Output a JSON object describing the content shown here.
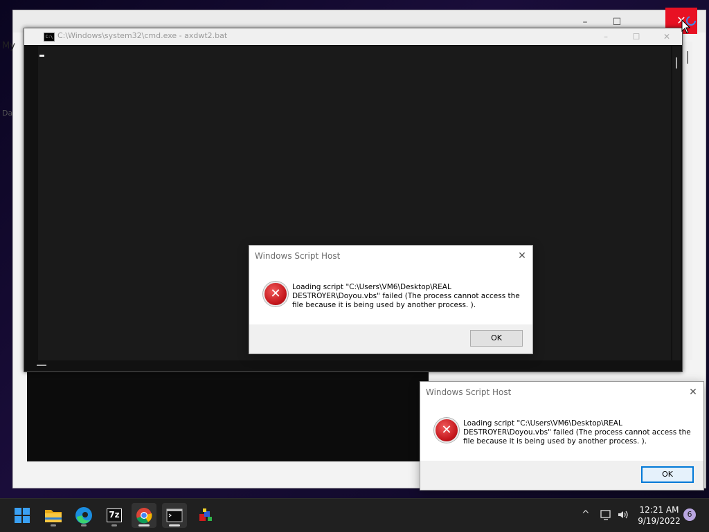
{
  "background_window": {
    "left_text_1": "My",
    "left_text_2": "Da",
    "minimize_glyph": "–",
    "maximize_glyph": "☐",
    "close_glyph": "✕"
  },
  "cmd_window": {
    "title": "C:\\Windows\\system32\\cmd.exe - axdwt2.bat",
    "icon_text": "C:\\",
    "minimize_glyph": "–",
    "maximize_glyph": "☐",
    "close_glyph": "✕"
  },
  "dialogs": [
    {
      "title": "Windows Script Host",
      "message": "Loading script \"C:\\Users\\VM6\\Desktop\\REAL DESTROYER\\Doyou.vbs\" failed (The process cannot access the file because it is being used by another process. ).",
      "ok_label": "OK",
      "close_glyph": "✕",
      "error_glyph": "✕"
    },
    {
      "title": "Windows Script Host",
      "message": "Loading script \"C:\\Users\\VM6\\Desktop\\REAL DESTROYER\\Doyou.vbs\" failed (The process cannot access the file because it is being used by another process. ).",
      "ok_label": "OK",
      "close_glyph": "✕",
      "error_glyph": "✕"
    }
  ],
  "taskbar": {
    "items": [
      {
        "name": "start-button",
        "icon": "windows-logo-icon"
      },
      {
        "name": "file-explorer",
        "icon": "folder-icon"
      },
      {
        "name": "edge",
        "icon": "edge-icon"
      },
      {
        "name": "7zip",
        "icon": "7zip-icon",
        "label": "7z"
      },
      {
        "name": "chrome",
        "icon": "chrome-icon"
      },
      {
        "name": "cmd",
        "icon": "terminal-icon"
      },
      {
        "name": "app",
        "icon": "app-icon"
      }
    ],
    "tray": {
      "chevron": "^",
      "time": "12:21 AM",
      "date": "9/19/2022",
      "notification_count": "6"
    }
  },
  "colors": {
    "close_red": "#e81123",
    "error_red": "#c4161c",
    "focus_blue": "#0078d7",
    "taskbar_bg": "#202020"
  }
}
